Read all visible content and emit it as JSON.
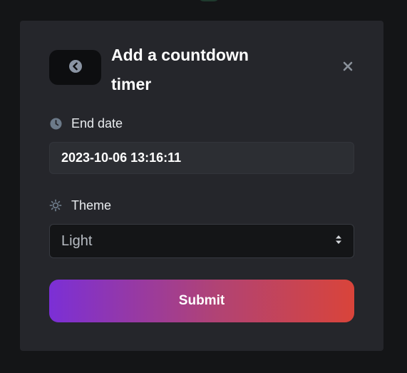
{
  "modal": {
    "title": "Add a countdown timer",
    "back_icon": "chevron-left-circle-icon",
    "close_icon": "close-icon"
  },
  "end_date": {
    "label": "End date",
    "icon": "clock-icon",
    "value": "2023-10-06 13:16:11"
  },
  "theme": {
    "label": "Theme",
    "icon": "sun-icon",
    "selected": "Light",
    "arrow_icon": "select-arrows-icon"
  },
  "submit": {
    "label": "Submit"
  },
  "colors": {
    "background": "#141517",
    "modal": "#25262b",
    "gradient_start": "#7b2fd6",
    "gradient_end": "#d9443a"
  }
}
